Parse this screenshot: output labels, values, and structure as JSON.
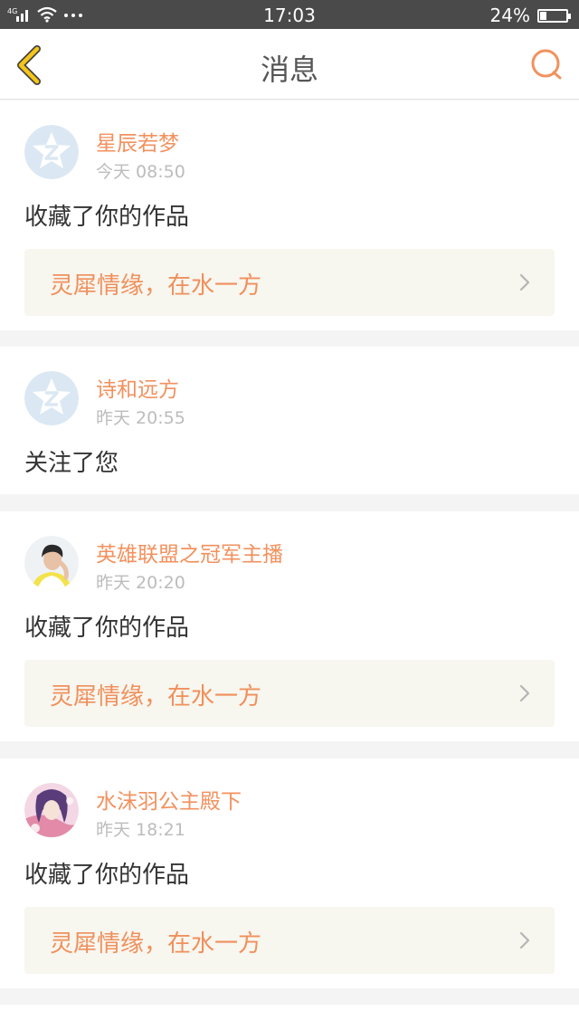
{
  "status_bar": {
    "network": "4G",
    "time": "17:03",
    "battery": "24%",
    "battery_level": 0.24
  },
  "header": {
    "title": "消息",
    "back_icon": "chevron-left-icon",
    "search_icon": "search-icon"
  },
  "colors": {
    "accent": "#f2915e",
    "header_back": "#f5c518",
    "card_link_bg": "#f7f6ef"
  },
  "messages": [
    {
      "user": "星辰若梦",
      "time": "今天 08:50",
      "action": "收藏了你的作品",
      "work": "灵犀情缘，在水一方",
      "avatar": "default-avatar"
    },
    {
      "user": "诗和远方",
      "time": "昨天 20:55",
      "action": "关注了您",
      "avatar": "default-avatar"
    },
    {
      "user": "英雄联盟之冠军主播",
      "time": "昨天 20:20",
      "action": "收藏了你的作品",
      "work": "灵犀情缘，在水一方",
      "avatar": "photo-avatar"
    },
    {
      "user": "水沫羽公主殿下",
      "time": "昨天 18:21",
      "action": "收藏了你的作品",
      "work": "灵犀情缘，在水一方",
      "avatar": "anime-avatar"
    }
  ]
}
